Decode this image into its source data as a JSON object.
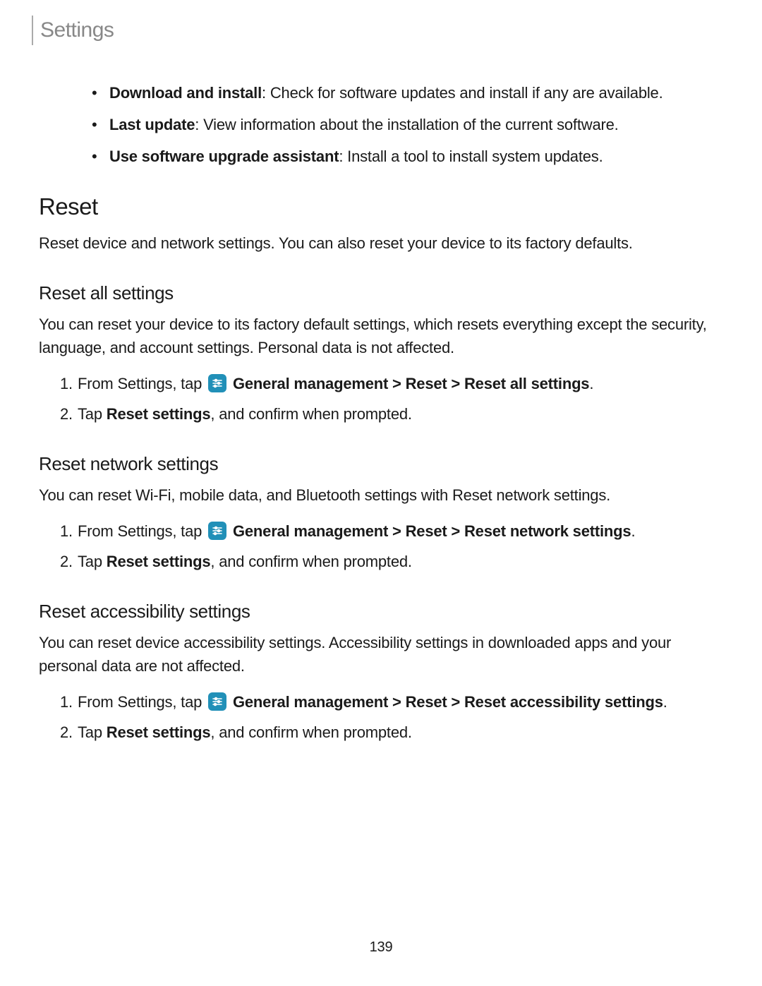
{
  "header": {
    "title": "Settings"
  },
  "bullets": [
    {
      "label": "Download and install",
      "desc": ": Check for software updates and install if any are available."
    },
    {
      "label": "Last update",
      "desc": ": View information about the installation of the current software."
    },
    {
      "label": "Use software upgrade assistant",
      "desc": ": Install a tool to install system updates."
    }
  ],
  "reset": {
    "heading": "Reset",
    "intro": "Reset device and network settings. You can also reset your device to its factory defaults."
  },
  "resetAll": {
    "heading": "Reset all settings",
    "intro": "You can reset your device to its factory default settings, which resets everything except the security, language, and account settings. Personal data is not affected.",
    "step1_pre": "From Settings, tap ",
    "step1_post": " General management > Reset > Reset all settings",
    "step1_period": ".",
    "step2_pre": "Tap ",
    "step2_bold": "Reset settings",
    "step2_post": ", and confirm when prompted."
  },
  "resetNetwork": {
    "heading": "Reset network settings",
    "intro": "You can reset Wi-Fi, mobile data, and Bluetooth settings with Reset network settings.",
    "step1_pre": "From Settings, tap ",
    "step1_post": " General management > Reset > Reset network settings",
    "step1_period": ".",
    "step2_pre": "Tap ",
    "step2_bold": "Reset settings",
    "step2_post": ", and confirm when prompted."
  },
  "resetAccessibility": {
    "heading": "Reset accessibility settings",
    "intro": "You can reset device accessibility settings. Accessibility settings in downloaded apps and your personal data are not affected.",
    "step1_pre": "From Settings, tap ",
    "step1_post": " General management > Reset > Reset accessibility settings",
    "step1_period": ".",
    "step2_pre": "Tap ",
    "step2_bold": "Reset settings",
    "step2_post": ", and confirm when prompted."
  },
  "ol_numbers": {
    "n1": "1.",
    "n2": "2."
  },
  "pageNumber": "139"
}
